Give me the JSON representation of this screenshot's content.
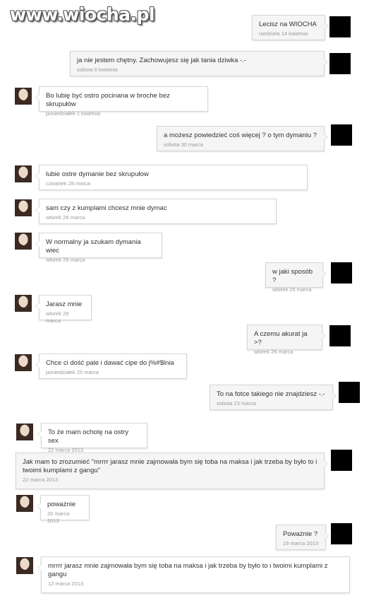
{
  "watermark": "www.wiocha.pl",
  "messages": [
    {
      "side": "out",
      "text": "Lecisz na WIOCHA",
      "time": "niedziela 14 kwietnia"
    },
    {
      "side": "out",
      "text": " ja nie jestem chętny. Zachowujesz się jak tania dziwka -.-",
      "time": "sobota 6 kwietnia"
    },
    {
      "side": "in",
      "text": "Bo lubię być ostro pocinana w broche bez skrupułów",
      "time": "poniedziałek 1 kwietnia"
    },
    {
      "side": "out",
      "text": "a możesz powiedzieć coś więcej ? o tym dymaniu ?",
      "time": "sobota 30 marca"
    },
    {
      "side": "in",
      "text": "lubie ostre dymanie bez skrupułow",
      "time": "czwartek 28 marca"
    },
    {
      "side": "in",
      "text": " sam czy z kumplami chcesz mnie dymac",
      "time": "wtorek 26 marca"
    },
    {
      "side": "in",
      "text": "W normalny ja szukam dymania wiec",
      "time": "wtorek 26 marca"
    },
    {
      "side": "out",
      "text": "w jaki sposób ?",
      "time": "wtorek 26 marca"
    },
    {
      "side": "in",
      "text": "Jarasz mnie",
      "time": "wtorek 26 marca"
    },
    {
      "side": "out",
      "text": "A czemu akurat ja >?",
      "time": "wtorek 26 marca"
    },
    {
      "side": "in",
      "text": "Chce ci dość pale i dawać cipe do j%#$lnia",
      "time": "poniedziałek 25 marca"
    },
    {
      "side": "out",
      "text": "To na fotce takiego nie znajdziesz -.-",
      "time": "sobota 23 marca"
    },
    {
      "side": "in",
      "text": "To że mam ochotę na ostry sex",
      "time": "22 marca 2013"
    },
    {
      "side": "out",
      "text": "Jak mam to zrozumieć \"mrrrr jarasz mnie zajmowała bym się toba na maksa i jak trzeba by było to i twoimi kumplami z gangu\"",
      "time": "22 marca 2013"
    },
    {
      "side": "in",
      "text": "poważnie",
      "time": "20 marca 2013"
    },
    {
      "side": "out",
      "text": "Poważnie ?",
      "time": "19 marca 2013"
    },
    {
      "side": "in",
      "text": "mrrrr jarasz mnie zajmowała bym się toba na maksa i jak trzeba by było to i twoimi kumplami z gangu",
      "time": "12 marca 2013"
    }
  ]
}
